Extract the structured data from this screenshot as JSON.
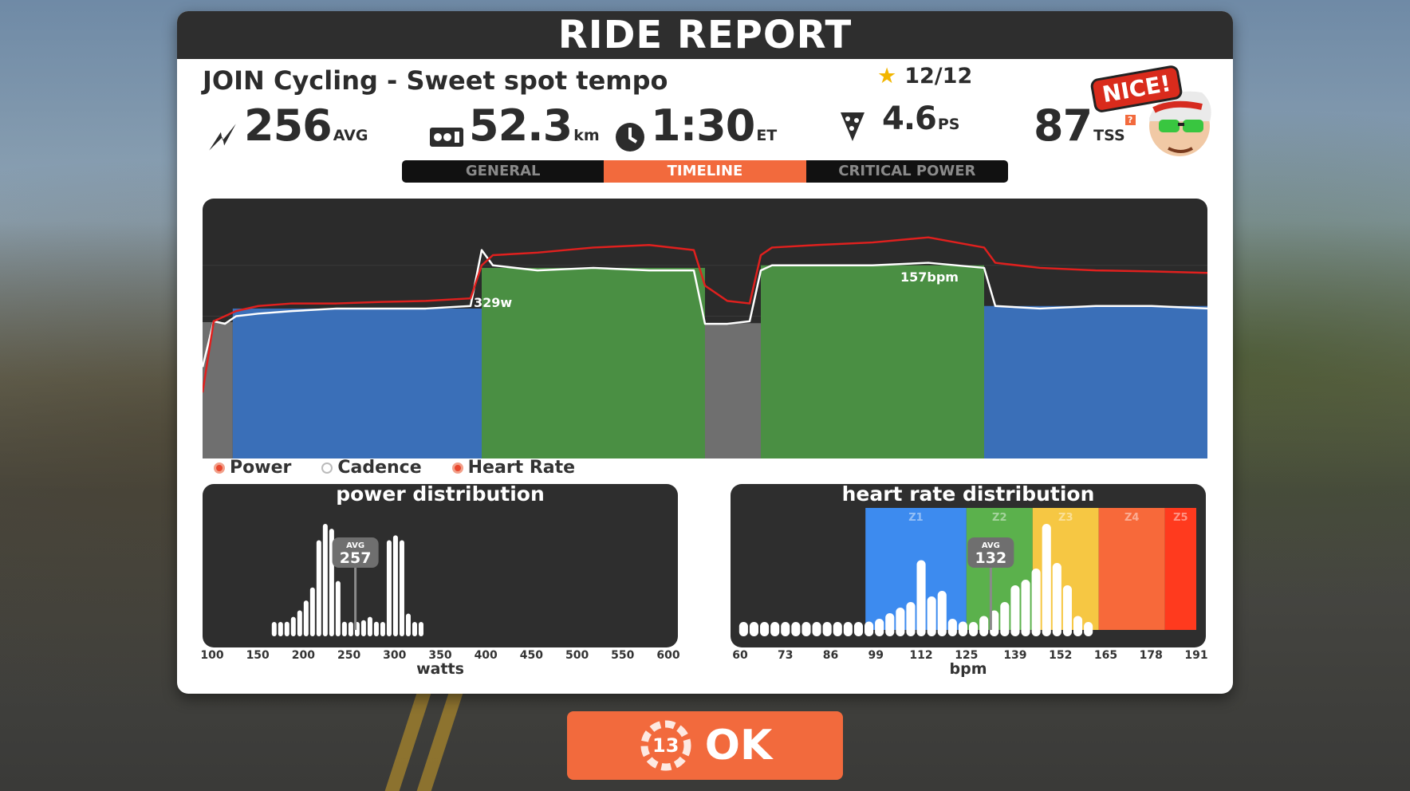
{
  "title": "RIDE REPORT",
  "workout_name": "JOIN Cycling - Sweet spot tempo",
  "stars": "12/12",
  "stats": {
    "power": {
      "value": "256",
      "unit": "AVG"
    },
    "distance": {
      "value": "52.3",
      "unit": "km"
    },
    "time": {
      "value": "1:30",
      "unit": "ET"
    },
    "pizza": {
      "value": "4.6",
      "unit": "PS"
    },
    "tss": {
      "value": "87",
      "unit": "TSS",
      "info": "?"
    }
  },
  "badge": "NICE!",
  "tabs": [
    {
      "label": "GENERAL",
      "active": false
    },
    {
      "label": "TIMELINE",
      "active": true
    },
    {
      "label": "CRITICAL POWER",
      "active": false
    }
  ],
  "timeline": {
    "peak_power_label": "329w",
    "peak_hr_label": "157bpm"
  },
  "legend": [
    {
      "label": "Power",
      "on": true
    },
    {
      "label": "Cadence",
      "on": false
    },
    {
      "label": "Heart Rate",
      "on": true
    }
  ],
  "chart_data": [
    {
      "type": "bar",
      "title": "power distribution",
      "xlabel": "watts",
      "x_ticks": [
        "100",
        "150",
        "200",
        "250",
        "300",
        "350",
        "400",
        "450",
        "500",
        "550",
        "600"
      ],
      "xlim": [
        100,
        600
      ],
      "bin_width": 7,
      "bins_x": [
        168,
        175,
        182,
        189,
        196,
        203,
        210,
        217,
        224,
        231,
        238,
        245,
        252,
        259,
        266,
        273,
        280,
        287,
        294,
        301,
        308,
        315,
        322,
        329
      ],
      "values": [
        1,
        3,
        5,
        8,
        12,
        18,
        26,
        55,
        65,
        62,
        30,
        5,
        3,
        4,
        6,
        8,
        5,
        4,
        55,
        58,
        55,
        10,
        3,
        1
      ],
      "avg_label": "AVG",
      "avg_value": "257"
    },
    {
      "type": "bar",
      "title": "heart rate distribution",
      "xlabel": "bpm",
      "x_ticks": [
        "60",
        "73",
        "86",
        "99",
        "112",
        "125",
        "139",
        "152",
        "165",
        "178",
        "191"
      ],
      "xlim": [
        60,
        191
      ],
      "zones": [
        {
          "name": "Z1",
          "from": 96,
          "to": 125,
          "color": "#3d8bef"
        },
        {
          "name": "Z2",
          "from": 125,
          "to": 144,
          "color": "#5bb14c"
        },
        {
          "name": "Z3",
          "from": 144,
          "to": 163,
          "color": "#f6c743"
        },
        {
          "name": "Z4",
          "from": 163,
          "to": 182,
          "color": "#f7693a"
        },
        {
          "name": "Z5",
          "from": 182,
          "to": 191,
          "color": "#ff3a1e"
        }
      ],
      "bin_width": 3,
      "bins_x": [
        61,
        64,
        67,
        70,
        73,
        76,
        79,
        82,
        85,
        88,
        91,
        94,
        97,
        100,
        103,
        106,
        109,
        112,
        115,
        118,
        121,
        124,
        127,
        130,
        133,
        136,
        139,
        142,
        145,
        148,
        151,
        154,
        157,
        160
      ],
      "values": [
        2,
        2,
        2,
        2,
        2,
        2,
        2,
        2,
        2,
        2,
        2,
        2,
        3,
        4,
        6,
        8,
        10,
        25,
        12,
        14,
        4,
        3,
        2,
        5,
        7,
        10,
        16,
        18,
        22,
        38,
        24,
        16,
        5,
        2
      ],
      "avg_label": "AVG",
      "avg_value": "132"
    },
    {
      "type": "line",
      "title": "",
      "x_unit": "min",
      "xlim": [
        0,
        90
      ],
      "ylim": [
        0,
        400
      ],
      "blocks": [
        {
          "from": 0,
          "to": 2.7,
          "zone": "gray"
        },
        {
          "from": 2.7,
          "to": 25,
          "zone": "blue"
        },
        {
          "from": 25,
          "to": 45,
          "zone": "green"
        },
        {
          "from": 45,
          "to": 50,
          "zone": "gray"
        },
        {
          "from": 50,
          "to": 70,
          "zone": "green"
        },
        {
          "from": 70,
          "to": 90,
          "zone": "blue"
        }
      ],
      "series": [
        {
          "name": "Power",
          "color": "#ffffff",
          "x": [
            0,
            1,
            2,
            3,
            5,
            8,
            12,
            16,
            20,
            24,
            25,
            26,
            30,
            35,
            40,
            44,
            45,
            47,
            49,
            50,
            51,
            55,
            60,
            65,
            70,
            71,
            75,
            80,
            85,
            90
          ],
          "y": [
            100,
            190,
            185,
            200,
            205,
            210,
            215,
            215,
            215,
            220,
            330,
            300,
            290,
            295,
            290,
            290,
            185,
            185,
            190,
            290,
            300,
            300,
            300,
            305,
            295,
            220,
            215,
            220,
            220,
            215
          ]
        },
        {
          "name": "Heart Rate",
          "color": "#e0201e",
          "x": [
            0,
            1,
            2,
            3,
            5,
            8,
            12,
            16,
            20,
            24,
            25,
            26,
            30,
            35,
            40,
            44,
            45,
            47,
            49,
            50,
            51,
            55,
            60,
            65,
            70,
            71,
            75,
            80,
            85,
            90
          ],
          "y": [
            50,
            190,
            200,
            210,
            220,
            225,
            225,
            228,
            230,
            235,
            300,
            320,
            325,
            335,
            340,
            330,
            260,
            230,
            225,
            320,
            335,
            340,
            345,
            355,
            335,
            305,
            295,
            290,
            288,
            285
          ]
        }
      ]
    }
  ],
  "ok_button": {
    "label": "OK",
    "countdown": "13"
  }
}
